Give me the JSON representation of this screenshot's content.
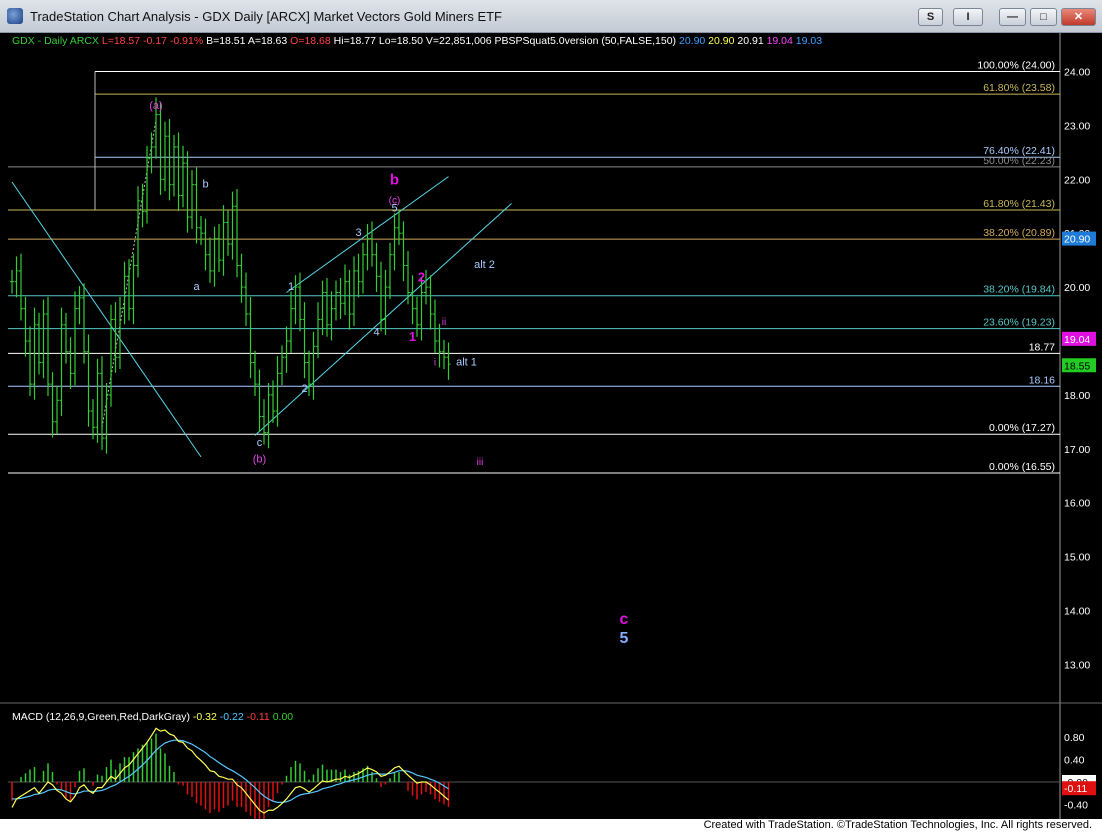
{
  "window": {
    "title": "TradeStation Chart Analysis - GDX Daily [ARCX] Market Vectors Gold Miners ETF",
    "buttons": {
      "s": "S",
      "i": "I",
      "minimize": "—",
      "maximize": "□",
      "close": "✕"
    }
  },
  "header": {
    "symbol": "GDX - Daily  ARCX",
    "last": "L=18.57",
    "change": "-0.17",
    "pct": "-0.91%",
    "bid": "B=18.51",
    "ask": "A=18.63",
    "open": "O=18.68",
    "high": "Hi=18.77",
    "low": "Lo=18.50",
    "volume": "V=22,851,006",
    "indicator": "PBSPSquat5.0version (50,FALSE,150)",
    "ind_values": [
      "20.90",
      "20.90",
      "20.91",
      "19.04",
      "19.03"
    ],
    "ind_colors": [
      "#3fa0ff",
      "#ffff55",
      "#ffffff",
      "#ff44ff",
      "#3fa0ff"
    ]
  },
  "footer": {
    "text": "Created with TradeStation. ©TradeStation Technologies, Inc. All rights reserved."
  },
  "chart_data": {
    "type": "line",
    "price_axis": {
      "ticks": [
        "24.00",
        "23.00",
        "22.00",
        "21.00",
        "20.00",
        "19.00",
        "18.00",
        "17.00",
        "16.00",
        "15.00",
        "14.00",
        "13.00"
      ]
    },
    "price_series": {
      "name": "GDX Daily",
      "color": "#33cc33",
      "closes": [
        20.1,
        20.3,
        19.6,
        19.0,
        18.2,
        19.3,
        18.6,
        19.5,
        18.2,
        17.5,
        17.9,
        19.3,
        18.8,
        18.4,
        19.6,
        19.8,
        18.8,
        17.7,
        17.4,
        18.4,
        17.2,
        18.0,
        19.4,
        18.7,
        19.6,
        20.2,
        19.6,
        20.4,
        21.6,
        21.4,
        22.4,
        22.6,
        23.2,
        22.0,
        22.8,
        21.9,
        22.6,
        21.7,
        22.3,
        21.3,
        21.9,
        21.1,
        21.0,
        20.6,
        20.3,
        20.9,
        20.5,
        21.2,
        20.8,
        21.5,
        20.4,
        20.0,
        19.5,
        18.6,
        18.2,
        17.6,
        17.3,
        18.0,
        17.7,
        18.4,
        18.7,
        19.0,
        19.6,
        20.0,
        19.4,
        18.6,
        18.2,
        18.9,
        19.4,
        19.9,
        19.3,
        19.6,
        19.9,
        19.7,
        20.1,
        19.5,
        20.3,
        20.1,
        20.6,
        20.9,
        20.6,
        20.2,
        19.4,
        20.0,
        20.6,
        21.1,
        21.0,
        20.4,
        19.9,
        19.6,
        19.3,
        19.9,
        20.0,
        19.5,
        19.0,
        18.8,
        18.7,
        18.57
      ]
    },
    "fib_levels": [
      {
        "label": "100.00% (24.00)",
        "price": 24.0,
        "color": "#ffffff"
      },
      {
        "label": "61.80% (23.58)",
        "price": 23.58,
        "color": "#c9b75a"
      },
      {
        "label": "76.40% (22.41)",
        "price": 22.41,
        "color": "#aaccff"
      },
      {
        "label": "50.00% (22.23)",
        "price": 22.23,
        "color": "#8a8a8a"
      },
      {
        "label": "61.80% (21.43)",
        "price": 21.43,
        "color": "#c9b75a"
      },
      {
        "label": "38.20% (20.89)",
        "price": 20.89,
        "color": "#d2a95a"
      },
      {
        "label": "38.20% (19.84)",
        "price": 19.84,
        "color": "#55c8c8"
      },
      {
        "label": "23.60% (19.23)",
        "price": 19.23,
        "color": "#55c8c8"
      },
      {
        "label": "18.77",
        "price": 18.77,
        "color": "#ffffff"
      },
      {
        "label": "18.16",
        "price": 18.16,
        "color": "#aaccff"
      },
      {
        "label": "0.00% (17.27)",
        "price": 17.27,
        "color": "#ffffff"
      },
      {
        "label": "0.00% (16.55)",
        "price": 16.55,
        "color": "#ffffff"
      }
    ],
    "price_tags": [
      {
        "text": "20.90",
        "price": 20.9,
        "bg": "#1e7bd8",
        "fg": "#ffffff"
      },
      {
        "text": "19.04",
        "price": 19.04,
        "bg": "#e010e0",
        "fg": "#ffffff"
      },
      {
        "text": "18.55",
        "price": 18.55,
        "bg": "#22cc22",
        "fg": "#000000"
      }
    ],
    "wave_labels": [
      {
        "text": "(a)",
        "bar": 32,
        "price": 23.3,
        "color": "#e040e0",
        "size": 11
      },
      {
        "text": "b",
        "bar": 43,
        "price": 21.85,
        "color": "#aaccff",
        "size": 11
      },
      {
        "text": "a",
        "bar": 41,
        "price": 19.95,
        "color": "#aaccff",
        "size": 11
      },
      {
        "text": "c",
        "bar": 55,
        "price": 17.05,
        "color": "#aaccff",
        "size": 11
      },
      {
        "text": "(b)",
        "bar": 55,
        "price": 16.75,
        "color": "#e040e0",
        "size": 11
      },
      {
        "text": "1",
        "bar": 62,
        "price": 19.95,
        "color": "#aaccff",
        "size": 11
      },
      {
        "text": "2",
        "bar": 65,
        "price": 18.05,
        "color": "#aaccff",
        "size": 11
      },
      {
        "text": "3",
        "bar": 77,
        "price": 20.95,
        "color": "#aaccff",
        "size": 11
      },
      {
        "text": "4",
        "bar": 81,
        "price": 19.1,
        "color": "#aaccff",
        "size": 11
      },
      {
        "text": "5",
        "bar": 85,
        "price": 21.4,
        "color": "#aaccff",
        "size": 11
      },
      {
        "text": "(c)",
        "bar": 85,
        "price": 21.55,
        "color": "#e040e0",
        "size": 10
      },
      {
        "text": "b",
        "bar": 85,
        "price": 21.9,
        "color": "#e010e0",
        "size": 15,
        "bold": true
      },
      {
        "text": "2",
        "bar": 91,
        "price": 20.1,
        "color": "#e010e0",
        "size": 13,
        "bold": true
      },
      {
        "text": "1",
        "bar": 89,
        "price": 19.0,
        "color": "#e010e0",
        "size": 13,
        "bold": true
      },
      {
        "text": "ii",
        "bar": 96,
        "price": 19.3,
        "color": "#e040e0",
        "size": 10
      },
      {
        "text": "i",
        "bar": 94,
        "price": 18.55,
        "color": "#e040e0",
        "size": 10
      },
      {
        "text": "iii",
        "bar": 104,
        "price": 16.7,
        "color": "#e040e0",
        "size": 10
      },
      {
        "text": "alt 2",
        "bar": 105,
        "price": 20.35,
        "color": "#aaccff",
        "size": 11
      },
      {
        "text": "alt 1",
        "bar": 101,
        "price": 18.55,
        "color": "#aaccff",
        "size": 11
      },
      {
        "text": "c",
        "bar": 136,
        "price": 13.75,
        "color": "#e010e0",
        "size": 16,
        "bold": true
      },
      {
        "text": "5",
        "bar": 136,
        "price": 13.4,
        "color": "#88aaff",
        "size": 16,
        "bold": true
      }
    ],
    "trendlines": [
      {
        "from": [
          0,
          21.95
        ],
        "to": [
          42,
          16.85
        ],
        "color": "#55d8e8"
      },
      {
        "from": [
          54,
          17.25
        ],
        "to": [
          111,
          21.55
        ],
        "color": "#55d8e8"
      },
      {
        "from": [
          61,
          19.9
        ],
        "to": [
          97,
          22.05
        ],
        "color": "#55d8e8"
      }
    ],
    "macd": {
      "label": "MACD (12,26,9,Green,Red,DarkGray)",
      "values": [
        "-0.32",
        "-0.22",
        "-0.11",
        "0.00"
      ],
      "value_colors": [
        "#ffff55",
        "#55c8ff",
        "#ff4444",
        "#33cc33"
      ],
      "axis_ticks": [
        "0.80",
        "0.40",
        "0.00",
        "-0.40"
      ],
      "tags": [
        {
          "text": "-0.00",
          "value": 0.0,
          "bg": "#ffffff",
          "fg": "#000000"
        },
        {
          "text": "-0.11",
          "value": -0.11,
          "bg": "#e01010",
          "fg": "#ffffff"
        }
      ],
      "macd_line": [
        -0.45,
        -0.3,
        -0.25,
        -0.2,
        -0.15,
        -0.1,
        -0.2,
        -0.1,
        0.0,
        -0.05,
        -0.15,
        -0.2,
        -0.3,
        -0.35,
        -0.25,
        -0.1,
        -0.05,
        -0.15,
        -0.2,
        -0.1,
        -0.1,
        0.0,
        0.1,
        0.05,
        0.15,
        0.25,
        0.3,
        0.4,
        0.5,
        0.6,
        0.7,
        0.82,
        0.95,
        0.9,
        0.92,
        0.85,
        0.82,
        0.72,
        0.7,
        0.6,
        0.55,
        0.45,
        0.38,
        0.3,
        0.2,
        0.18,
        0.1,
        0.08,
        0.05,
        0.05,
        -0.05,
        -0.1,
        -0.2,
        -0.3,
        -0.4,
        -0.5,
        -0.55,
        -0.5,
        -0.5,
        -0.45,
        -0.38,
        -0.3,
        -0.2,
        -0.1,
        -0.08,
        -0.12,
        -0.18,
        -0.12,
        -0.05,
        0.02,
        0.0,
        0.02,
        0.05,
        0.05,
        0.1,
        0.08,
        0.12,
        0.15,
        0.2,
        0.25,
        0.22,
        0.18,
        0.1,
        0.12,
        0.18,
        0.25,
        0.28,
        0.2,
        0.12,
        0.05,
        -0.02,
        0.0,
        0.0,
        -0.05,
        -0.12,
        -0.18,
        -0.25,
        -0.32
      ],
      "signal_line": [
        -0.3,
        -0.3,
        -0.29,
        -0.27,
        -0.25,
        -0.22,
        -0.21,
        -0.19,
        -0.15,
        -0.13,
        -0.13,
        -0.14,
        -0.17,
        -0.2,
        -0.21,
        -0.19,
        -0.16,
        -0.16,
        -0.17,
        -0.16,
        -0.15,
        -0.12,
        -0.08,
        -0.05,
        0.0,
        0.05,
        0.1,
        0.16,
        0.23,
        0.3,
        0.38,
        0.47,
        0.56,
        0.63,
        0.69,
        0.72,
        0.74,
        0.74,
        0.73,
        0.7,
        0.67,
        0.62,
        0.57,
        0.52,
        0.45,
        0.4,
        0.34,
        0.29,
        0.24,
        0.2,
        0.15,
        0.1,
        0.04,
        -0.03,
        -0.1,
        -0.18,
        -0.25,
        -0.3,
        -0.34,
        -0.36,
        -0.36,
        -0.35,
        -0.32,
        -0.27,
        -0.23,
        -0.21,
        -0.2,
        -0.18,
        -0.16,
        -0.12,
        -0.1,
        -0.08,
        -0.05,
        -0.03,
        0.0,
        0.02,
        0.04,
        0.06,
        0.09,
        0.12,
        0.14,
        0.15,
        0.14,
        0.14,
        0.15,
        0.17,
        0.2,
        0.2,
        0.19,
        0.16,
        0.12,
        0.1,
        0.08,
        0.05,
        0.02,
        -0.02,
        -0.07,
        -0.12
      ]
    }
  }
}
